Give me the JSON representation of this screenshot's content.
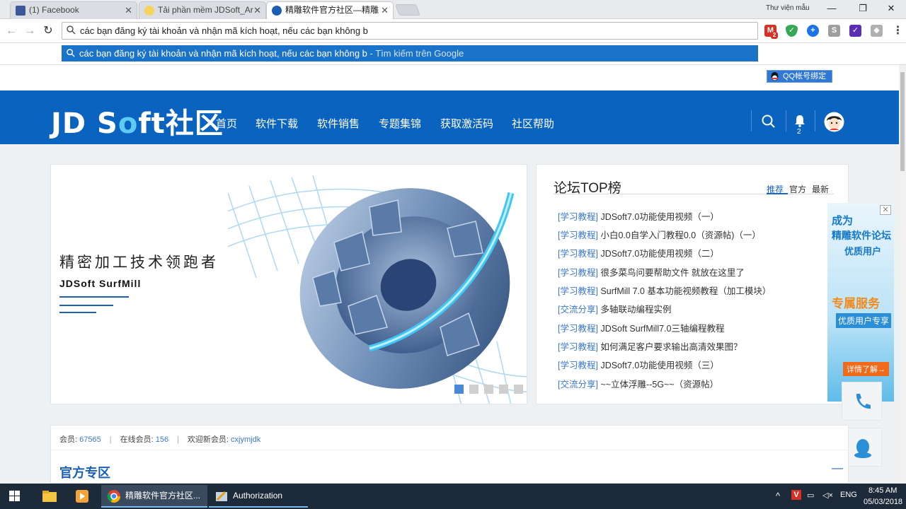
{
  "browser": {
    "tabs": [
      {
        "title": "(1) Facebook",
        "close": "✕"
      },
      {
        "title": "Tải phần mềm JDSoft_Ar",
        "close": "✕"
      },
      {
        "title": "精雕软件官方社区—精雕",
        "close": "✕"
      }
    ],
    "window_label": "Thư viện mẫu",
    "controls": {
      "minimize": "—",
      "maximize": "❐",
      "close": "✕"
    },
    "address_value": "các bạn đăng ký tài khoản và nhận mã kích hoạt, nếu các bạn không b",
    "suggestion": {
      "text": "các bạn đăng ký tài khoản và nhận mã kích hoạt, nếu các bạn không b",
      "sub": " - Tìm kiếm trên Google"
    },
    "ext_badge": "2"
  },
  "site": {
    "qq_bind": "QQ帐号绑定",
    "logo": {
      "a": "JD S",
      "o": "o",
      "b": "ft社区"
    },
    "nav": [
      "首页",
      "软件下载",
      "软件销售",
      "专题集锦",
      "获取激活码",
      "社区帮助"
    ],
    "notif_count": "2"
  },
  "banner": {
    "headline": "精密加工技术领跑者",
    "product": "JDSoft SurfMill"
  },
  "forum_top": {
    "title": "论坛TOP榜",
    "tabs": [
      "推荐",
      "官方",
      "最新"
    ],
    "rows": [
      {
        "cat": "[学习教程]",
        "text": "JDSoft7.0功能使用视频（一）"
      },
      {
        "cat": "[学习教程]",
        "text": "小白0.0自学入门教程0.0（资源帖)（一）"
      },
      {
        "cat": "[学习教程]",
        "text": "JDSoft7.0功能使用视频（二）"
      },
      {
        "cat": "[学习教程]",
        "text": "很多菜鸟问要帮助文件   就放在这里了"
      },
      {
        "cat": "[学习教程]",
        "text": "SurfMill 7.0 基本功能视频教程（加工模块）"
      },
      {
        "cat": "[交流分享]",
        "text": "多轴联动编程实例"
      },
      {
        "cat": "[学习教程]",
        "text": "JDSoft SurfMill7.0三轴编程教程"
      },
      {
        "cat": "[学习教程]",
        "text": "如何满足客户要求输出高清效果图？"
      },
      {
        "cat": "[学习教程]",
        "text": "JDSoft7.0功能使用视频（三）"
      },
      {
        "cat": "[交流分享]",
        "text": "~~立体浮雕--5G~~（资源帖）"
      }
    ]
  },
  "float_ad": {
    "l1": "成为",
    "l2": "精雕软件论坛",
    "l3": "优质用户",
    "l4": "专属服务",
    "l5": "优质用户专享",
    "l6": "详情了解→"
  },
  "stats": {
    "members_label": "会员:",
    "members": "67565",
    "online_label": "在线会员:",
    "online": "156",
    "welcome_label": "欢迎新会员:",
    "newest": "cxjymjdk",
    "section": "官方专区",
    "collapse": "—"
  },
  "taskbar": {
    "apps": [
      "精雕软件官方社区...",
      "Authorization"
    ],
    "lang": "ENG",
    "time": "8:45 AM",
    "date": "05/03/2018"
  }
}
